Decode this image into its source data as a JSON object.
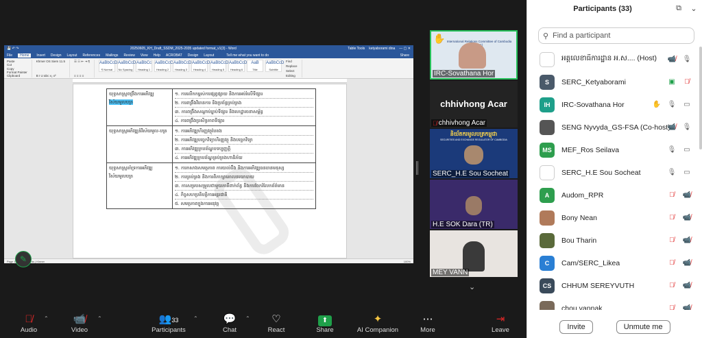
{
  "word": {
    "filename": "20250605_KH_Draft_SSDM_2025-2035 updated format_v1(3) - Word",
    "tools_label": "Table Tools",
    "user": "ketyaborami dina",
    "tabs": [
      "File",
      "Home",
      "Insert",
      "Design",
      "Layout",
      "References",
      "Mailings",
      "Review",
      "View",
      "Help",
      "ACROBAT",
      "Design",
      "Layout"
    ],
    "tell_me": "Tell me what you want to do",
    "share": "Share",
    "ribbon": {
      "paste": "Paste",
      "cut": "Cut",
      "copy": "Copy",
      "format_painter": "Format Painter",
      "clipboard": "Clipboard",
      "font": "Khmer OS Siem",
      "size": "11.5",
      "editing": "Editing",
      "find": "Find",
      "replace": "Replace",
      "select": "Select"
    },
    "styles": [
      {
        "sample": "AaBbCcDd",
        "name": "¶ Normal"
      },
      {
        "sample": "AaBbCcDd",
        "name": "No Spacing"
      },
      {
        "sample": "AaBbCc",
        "name": "Heading 1"
      },
      {
        "sample": "AaBbCcC",
        "name": "Heading 2"
      },
      {
        "sample": "AaBbCcD",
        "name": "Heading 3"
      },
      {
        "sample": "AaBbCcDd",
        "name": "Heading 4"
      },
      {
        "sample": "AaBbCcDd",
        "name": "Heading 5"
      },
      {
        "sample": "AaBbCcDd",
        "name": "Heading 6"
      },
      {
        "sample": "AaB",
        "name": "Title"
      },
      {
        "sample": "AaBbCcD",
        "name": "Subtitle"
      }
    ],
    "status_left": "Page 12 of 1 | 0 words | Khmer",
    "zoom": "100%",
    "table": [
      {
        "col1": "យុទ្ធសាស្ត្រពង្រឹងការអភិវឌ្ឍ",
        "col1_hl": "វិស័យមូលបត្រ",
        "items": [
          "១. ការលើកកម្ពស់ការផ្សព្វផ្សាយ និងការអប់រំលើទីផ្សារ",
          "២. ការពង្រឹងវិធានការ និងប្រព័ន្ធគ្រប់គ្រង",
          "៣. ការពង្រឹងសណ្តាប់ធ្នាប់ទីផ្សារ និងហេដ្ឋារចនាសម្ព័ន្ធ",
          "៤. ការពង្រឹងប្រសិទ្ធភាពទីផ្សារ"
        ]
      },
      {
        "col1": "យុទ្ធសាស្ត្រអភិវឌ្ឍន៍វិស័យមូល-បត្រ",
        "col1_hl": "",
        "items": [
          "១. ការអភិវឌ្ឍហិរញ្ញវត្ថុបៃតង",
          "២. ការអភិវឌ្ឍបច្ចេកវិទ្យាហិរញ្ញវត្ថុ និងបច្ចេកវិទ្យា",
          "៣. ការអភិវឌ្ឍក្របខ័ណ្ឌបទប្បញ្ញត្តិ",
          "៤. ការអភិវឌ្ឍក្របខ័ណ្ឌគ្រប់គ្រងហានិភ័យ"
        ]
      },
      {
        "col1": "យុទ្ធសាស្ត្រគាំទ្រការអភិវឌ្ឍ",
        "col1_hl": "វិស័យមូលបត្រ",
        "items": [
          "១. ការកសាងសមត្ថភាព ការយល់ដឹង និងការអភិវឌ្ឍធនធានមនុស្ស",
          "២. ការគ្រប់គ្រង និងការពិភាក្សាគោលនយោបាយ",
          "៣. ការសម្របសម្រួលជាមួយភាគីពាក់ព័ន្ធ និងការចែករំលែកព័ត៌មាន",
          "៤. កិច្ចសហប្រតិបត្តិការអន្តរជាតិ",
          "៥. សមត្ថភាពក្នុងការអនុវត្ត"
        ]
      }
    ]
  },
  "tiles": [
    {
      "name": "IRC-Sovathana Hor",
      "banner": "International Relations Committee of Cambodia (IRC)"
    },
    {
      "name": "chhivhong Acar",
      "big": "chhivhong Acar"
    },
    {
      "name": "SERC_H.E Sou Socheat",
      "banner": "និយ័តករមូលបត្រកម្ពុជា",
      "sub": "SECURITIES AND EXCHANGE REGULATOR OF CAMBODIA"
    },
    {
      "name": "H.E SOK Dara (TR)"
    },
    {
      "name": "MEY VANN"
    }
  ],
  "panel": {
    "title": "Participants (33)",
    "search_placeholder": "Find a participant",
    "invite": "Invite",
    "unmute": "Unmute me",
    "participants": [
      {
        "name": "អគ្គលេខាធិការដ្ឋាន អ.ស.... (Host)",
        "initials": "",
        "color": "#ffffff"
      },
      {
        "name": "SERC_Ketyaborami",
        "initials": "S",
        "color": "#4a5a6a"
      },
      {
        "name": "IRC-Sovathana Hor",
        "initials": "IH",
        "color": "#1e9f8a"
      },
      {
        "name": "SENG Nyvyda_GS-FSA (Co-host)",
        "initials": "",
        "color": "#555555"
      },
      {
        "name": "MEF_Ros Seilava",
        "initials": "MS",
        "color": "#2e9e4e"
      },
      {
        "name": "SERC_H.E Sou Socheat",
        "initials": "",
        "color": "#ffffff"
      },
      {
        "name": "Audom_RPR",
        "initials": "A",
        "color": "#2e9e4e"
      },
      {
        "name": "Bony Nean",
        "initials": "",
        "color": "#b07a5a"
      },
      {
        "name": "Bou Tharin",
        "initials": "",
        "color": "#5a6a3a"
      },
      {
        "name": "Cam/SERC_Likea",
        "initials": "C",
        "color": "#2a7fd4"
      },
      {
        "name": "CHHUM SEREYVUTH",
        "initials": "CS",
        "color": "#3a4a5a"
      },
      {
        "name": "chou vannak",
        "initials": "",
        "color": "#7a6a5a"
      }
    ]
  },
  "toolbar": {
    "audio": "Audio",
    "video": "Video",
    "participants": "Participants",
    "participants_count": "33",
    "chat": "Chat",
    "react": "React",
    "share": "Share",
    "ai": "AI Companion",
    "more": "More",
    "leave": "Leave"
  }
}
